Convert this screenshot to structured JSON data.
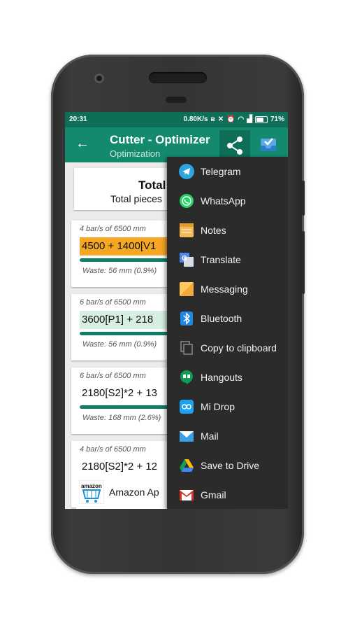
{
  "status_bar": {
    "time": "20:31",
    "net_speed": "0.80K/s",
    "battery": "71%"
  },
  "toolbar": {
    "title": "Cutter - Optimizer",
    "subtitle": "Optimization"
  },
  "summary": {
    "title": "Total",
    "pieces_label": "Total pieces"
  },
  "cards": [
    {
      "bars": "4 bar/s of 6500 mm",
      "cut": "4500 + 1400[V1",
      "waste": "Waste: 56 mm (0.9%)",
      "highlight": "#f5a623",
      "progress": 1.0
    },
    {
      "bars": "6 bar/s of 6500 mm",
      "cut": "3600[P1] + 218",
      "waste": "Waste: 56 mm (0.9%)",
      "highlight": "#d6efe0",
      "progress": 1.0
    },
    {
      "bars": "6 bar/s of 6500 mm",
      "cut": "2180[S2]*2 + 13",
      "waste": "Waste: 168 mm (2.6%)",
      "highlight": "#ffffff",
      "progress": 1.0
    },
    {
      "bars": "4 bar/s of 6500 mm",
      "cut": "2180[S2]*2 + 12",
      "waste": "",
      "highlight": "#ffffff",
      "progress": 1.0
    }
  ],
  "ad": {
    "logo_text": "amazon",
    "text": "Amazon Ap"
  },
  "share_menu": [
    {
      "label": "Telegram",
      "icon": "telegram-icon",
      "color": "#2ca5e0"
    },
    {
      "label": "WhatsApp",
      "icon": "whatsapp-icon",
      "color": "#25d366"
    },
    {
      "label": "Notes",
      "icon": "notes-icon",
      "color": "#f7b955"
    },
    {
      "label": "Translate",
      "icon": "translate-icon",
      "color": "#4a87f0"
    },
    {
      "label": "Messaging",
      "icon": "messaging-icon",
      "color": "#ffc859"
    },
    {
      "label": "Bluetooth",
      "icon": "bluetooth-icon",
      "color": "#1e88e5"
    },
    {
      "label": "Copy to clipboard",
      "icon": "copy-icon",
      "color": "#8a8a8a"
    },
    {
      "label": "Hangouts",
      "icon": "hangouts-icon",
      "color": "#0f9d58"
    },
    {
      "label": "Mi Drop",
      "icon": "midrop-icon",
      "color": "#1da1f2"
    },
    {
      "label": "Mail",
      "icon": "mail-icon",
      "color": "#3aa0e8"
    },
    {
      "label": "Save to Drive",
      "icon": "drive-icon",
      "color": "#fbbc04"
    },
    {
      "label": "Gmail",
      "icon": "gmail-icon",
      "color": "#d93025"
    }
  ]
}
